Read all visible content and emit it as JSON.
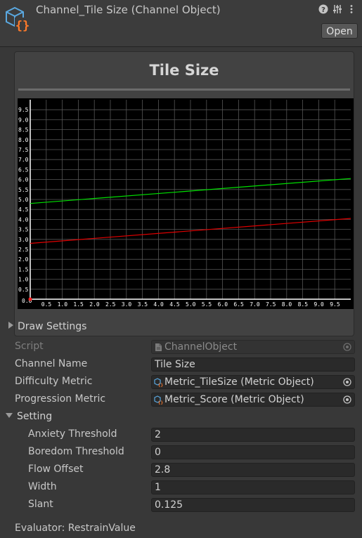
{
  "header": {
    "title": "Channel_Tile Size (Channel Object)",
    "open_label": "Open"
  },
  "preview": {
    "title": "Tile Size"
  },
  "chart_data": {
    "type": "line",
    "title": "",
    "xlabel": "",
    "ylabel": "",
    "xlim": [
      0,
      10
    ],
    "ylim": [
      0,
      10
    ],
    "grid": true,
    "x_ticks": [
      "0.5",
      "1.0",
      "1.5",
      "2.0",
      "2.5",
      "3.0",
      "3.5",
      "4.0",
      "4.5",
      "5.0",
      "5.5",
      "6.0",
      "6.5",
      "7.0",
      "7.5",
      "8.0",
      "8.5",
      "9.0",
      "9.5"
    ],
    "y_ticks": [
      "0.5",
      "1.0",
      "1.5",
      "2.0",
      "2.5",
      "3.0",
      "3.5",
      "4.0",
      "4.5",
      "5.0",
      "5.5",
      "6.0",
      "6.5",
      "7.0",
      "7.5",
      "8.0",
      "8.5",
      "9.0",
      "9.5"
    ],
    "origin_label": "0.0",
    "series": [
      {
        "color": "#00e000",
        "x": [
          0,
          10
        ],
        "y": [
          4.8,
          6.05
        ]
      },
      {
        "color": "#e00000",
        "x": [
          0,
          10
        ],
        "y": [
          2.8,
          4.05
        ]
      }
    ],
    "marker": {
      "x": 0,
      "y": 0,
      "color": "#ff2020"
    }
  },
  "draw_settings": {
    "label": "Draw Settings"
  },
  "props": {
    "script": {
      "label": "Script",
      "value": "ChannelObject"
    },
    "channel_name": {
      "label": "Channel Name",
      "value": "Tile Size"
    },
    "difficulty_metric": {
      "label": "Difficulty Metric",
      "value": "Metric_TileSize (Metric Object)"
    },
    "progression_metric": {
      "label": "Progression Metric",
      "value": "Metric_Score (Metric Object)"
    }
  },
  "setting": {
    "label": "Setting",
    "anxiety_threshold": {
      "label": "Anxiety Threshold",
      "value": "2"
    },
    "boredom_threshold": {
      "label": "Boredom Threshold",
      "value": "0"
    },
    "flow_offset": {
      "label": "Flow Offset",
      "value": "2.8"
    },
    "width": {
      "label": "Width",
      "value": "1"
    },
    "slant": {
      "label": "Slant",
      "value": "0.125"
    }
  },
  "evaluator": {
    "text": "Evaluator: RestrainValue"
  },
  "colors": {
    "background": "#383838",
    "field": "#2a2a2a",
    "accent_icon": "#5aa8e0",
    "brace": "#ff7a2a"
  }
}
